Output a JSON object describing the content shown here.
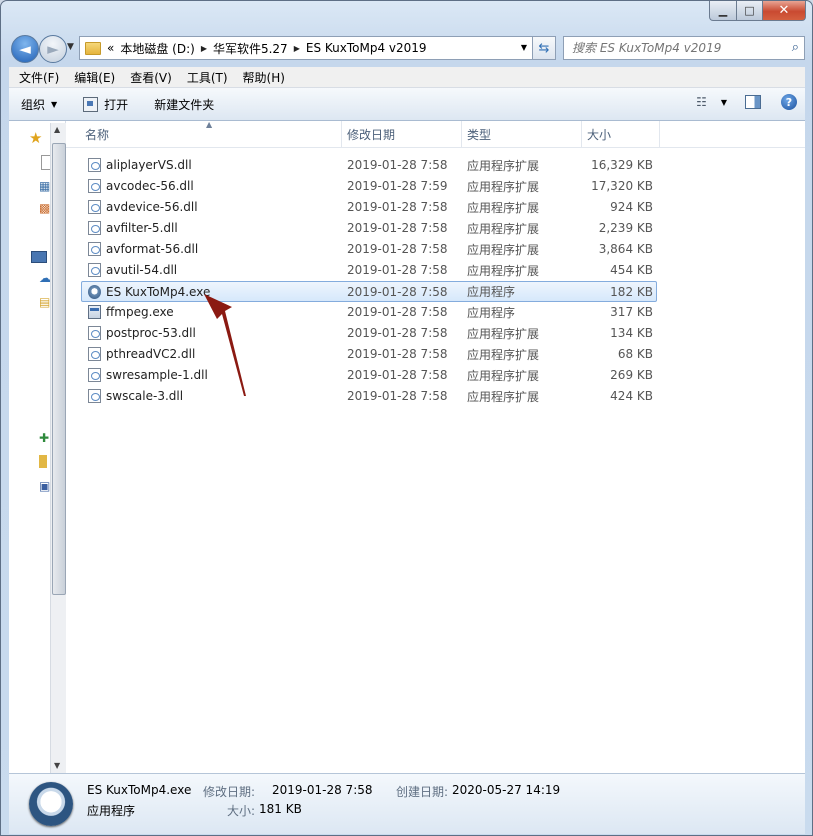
{
  "window": {
    "caption_min": "▁",
    "caption_max": "□",
    "caption_close": "✕"
  },
  "nav": {
    "back": "◄",
    "forward": "►"
  },
  "address": {
    "overflow": "«",
    "crumbs": [
      "本地磁盘 (D:)",
      "华军软件5.27",
      "ES KuxToMp4 v2019"
    ],
    "separator": "▶"
  },
  "search": {
    "placeholder": "搜索 ES KuxToMp4 v2019",
    "icon": "search-icon"
  },
  "menu": {
    "items": [
      "文件(F)",
      "编辑(E)",
      "查看(V)",
      "工具(T)",
      "帮助(H)"
    ]
  },
  "toolbar": {
    "organize": "组织",
    "open": "打开",
    "new_folder": "新建文件夹"
  },
  "columns": {
    "name": "名称",
    "date": "修改日期",
    "type": "类型",
    "size": "大小"
  },
  "files": [
    {
      "name": "aliplayerVS.dll",
      "date": "2019-01-28 7:58",
      "type": "应用程序扩展",
      "size": "16,329 KB",
      "icon": "dll-file-icon"
    },
    {
      "name": "avcodec-56.dll",
      "date": "2019-01-28 7:59",
      "type": "应用程序扩展",
      "size": "17,320 KB",
      "icon": "dll-file-icon"
    },
    {
      "name": "avdevice-56.dll",
      "date": "2019-01-28 7:58",
      "type": "应用程序扩展",
      "size": "924 KB",
      "icon": "dll-file-icon"
    },
    {
      "name": "avfilter-5.dll",
      "date": "2019-01-28 7:58",
      "type": "应用程序扩展",
      "size": "2,239 KB",
      "icon": "dll-file-icon"
    },
    {
      "name": "avformat-56.dll",
      "date": "2019-01-28 7:58",
      "type": "应用程序扩展",
      "size": "3,864 KB",
      "icon": "dll-file-icon"
    },
    {
      "name": "avutil-54.dll",
      "date": "2019-01-28 7:58",
      "type": "应用程序扩展",
      "size": "454 KB",
      "icon": "dll-file-icon"
    },
    {
      "name": "ES KuxToMp4.exe",
      "date": "2019-01-28 7:58",
      "type": "应用程序",
      "size": "182 KB",
      "icon": "es-kuxtomp4-app-icon"
    },
    {
      "name": "ffmpeg.exe",
      "date": "2019-01-28 7:58",
      "type": "应用程序",
      "size": "317 KB",
      "icon": "exe-file-icon"
    },
    {
      "name": "postproc-53.dll",
      "date": "2019-01-28 7:58",
      "type": "应用程序扩展",
      "size": "134 KB",
      "icon": "dll-file-icon"
    },
    {
      "name": "pthreadVC2.dll",
      "date": "2019-01-28 7:58",
      "type": "应用程序扩展",
      "size": "68 KB",
      "icon": "dll-file-icon"
    },
    {
      "name": "swresample-1.dll",
      "date": "2019-01-28 7:58",
      "type": "应用程序扩展",
      "size": "269 KB",
      "icon": "dll-file-icon"
    },
    {
      "name": "swscale-3.dll",
      "date": "2019-01-28 7:58",
      "type": "应用程序扩展",
      "size": "424 KB",
      "icon": "dll-file-icon"
    }
  ],
  "selected_index": 6,
  "details": {
    "name": "ES KuxToMp4.exe",
    "type": "应用程序",
    "modified_label": "修改日期:",
    "modified_value": "2019-01-28 7:58",
    "created_label": "创建日期:",
    "created_value": "2020-05-27 14:19",
    "size_label": "大小:",
    "size_value": "181 KB"
  },
  "colors": {
    "annotation_arrow": "#8b1a12",
    "selection_border": "#84acdd"
  }
}
